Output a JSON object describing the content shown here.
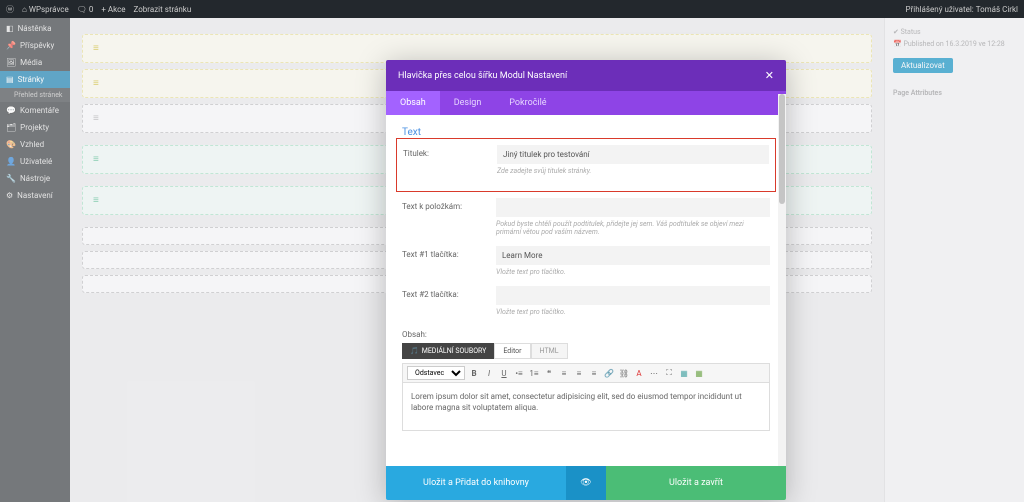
{
  "adminbar": {
    "site": "WPsprávce",
    "comments": "0",
    "new": "+ Akce",
    "view": "Zobrazit stránku",
    "user_prefix": "Přihlášený uživatel:",
    "user": "Tomáš Cirkl"
  },
  "sidebar": {
    "items": [
      {
        "label": "Nástěnka"
      },
      {
        "label": "Příspěvky"
      },
      {
        "label": "Média"
      },
      {
        "label": "Stránky",
        "active": true
      },
      {
        "label": "Přehled stránek",
        "sub": true
      },
      {
        "label": "Komentáře"
      },
      {
        "label": "Projekty"
      },
      {
        "label": "Vzhled"
      },
      {
        "label": "Uživatelé"
      },
      {
        "label": "Nástroje"
      },
      {
        "label": "Nastavení"
      }
    ]
  },
  "rightcol": {
    "status": "Status",
    "published": "Published on",
    "date": "16.3.2019 ve 12:28",
    "update_btn": "Aktualizovat",
    "page_attr": "Page Attributes"
  },
  "modal": {
    "title": "Hlavička přes celou šířku Modul Nastavení",
    "tabs": {
      "content": "Obsah",
      "design": "Design",
      "advanced": "Pokročilé"
    },
    "section": "Text",
    "fields": {
      "title_label": "Titulek:",
      "title_value": "Jiný titulek pro testování",
      "title_help": "Zde zadejte svůj titulek stránky.",
      "sub_label": "Text k položkám:",
      "sub_help": "Pokud byste chtěli použít podtitulek, přidejte jej sem. Váš podtitulek se objeví mezi primární větou pod vaším názvem.",
      "btn1_label": "Text #1 tlačítka:",
      "btn1_value": "Learn More",
      "btn1_help": "Vložte text pro tlačítko.",
      "btn2_label": "Text #2 tlačítka:",
      "btn2_help": "Vložte text pro tlačítko.",
      "content_label": "Obsah:",
      "media_btn": "MEDIÁLNÍ SOUBORY"
    },
    "editor": {
      "tab_visual": "Editor",
      "tab_html": "HTML",
      "format_select": "Odstavec",
      "content": "Lorem ipsum dolor sit amet, consectetur adipisicing elit, sed do eiusmod tempor incididunt ut labore magna sit voluptatem aliqua."
    },
    "footer": {
      "save_lib": "Uložit a Přidat do knihovny",
      "save_close": "Uložit a zavřít"
    }
  }
}
